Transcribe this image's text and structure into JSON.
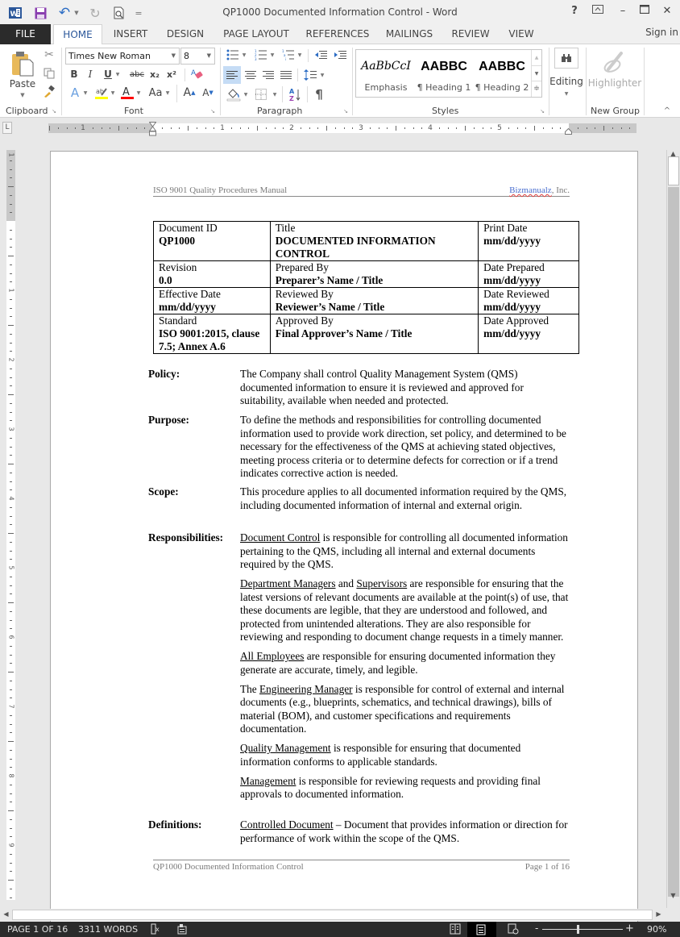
{
  "window": {
    "title": "QP1000 Documented Information Control - Word",
    "help": "?",
    "ribbon_display": "⊼",
    "minimize": "–",
    "maximize": "☐",
    "close": "✕"
  },
  "qat": {
    "app_icon": "W",
    "save_icon": "save-icon",
    "undo_icon": "↶",
    "redo_icon": "↻",
    "print_preview_icon": "print-preview-icon",
    "customize": "="
  },
  "tabs": [
    {
      "label": "FILE"
    },
    {
      "label": "HOME",
      "active": true
    },
    {
      "label": "INSERT"
    },
    {
      "label": "DESIGN"
    },
    {
      "label": "PAGE LAYOUT"
    },
    {
      "label": "REFERENCES"
    },
    {
      "label": "MAILINGS"
    },
    {
      "label": "REVIEW"
    },
    {
      "label": "VIEW"
    }
  ],
  "sign_in": "Sign in",
  "ribbon": {
    "clipboard": {
      "label": "Clipboard",
      "paste": "Paste"
    },
    "font": {
      "label": "Font",
      "font_name": "Times New Roman",
      "font_size": "8",
      "bold": "B",
      "italic": "I",
      "underline": "U",
      "strike": "abc",
      "subscript": "x₂",
      "superscript": "x²",
      "change_case": "Aa",
      "grow": "A",
      "shrink": "A",
      "text_effects": "A",
      "font_color": "A",
      "highlight_color": "#ffff00",
      "font_color_value": "#ff0000"
    },
    "paragraph": {
      "label": "Paragraph",
      "pilcrow": "¶"
    },
    "styles": {
      "label": "Styles",
      "items": [
        {
          "sample": "AaBbCcI",
          "name": "Emphasis"
        },
        {
          "sample": "AABBC",
          "name": "¶ Heading 1"
        },
        {
          "sample": "AABBC",
          "name": "¶ Heading 2"
        }
      ]
    },
    "editing": {
      "label": "Editing"
    },
    "new_group": {
      "label": "New Group",
      "highlighter": "Highlighter"
    }
  },
  "ruler": {
    "corner": "L",
    "numbers": [
      "1",
      "1",
      "2",
      "3",
      "4",
      "5"
    ],
    "vertical_numbers": [
      "1",
      "1",
      "2",
      "3",
      "4",
      "5",
      "6",
      "7",
      "8",
      "9"
    ]
  },
  "document": {
    "header_left": "ISO 9001 Quality Procedures Manual",
    "header_right_company": "Bizmanualz",
    "header_right_suffix": ", Inc.",
    "info_table": [
      [
        {
          "label": "Document ID",
          "value": "QP1000"
        },
        {
          "label": "Title",
          "value": "DOCUMENTED INFORMATION CONTROL"
        },
        {
          "label": "Print Date",
          "value": "mm/dd/yyyy"
        }
      ],
      [
        {
          "label": "Revision",
          "value": "0.0"
        },
        {
          "label": "Prepared By",
          "value": "Preparer’s Name / Title"
        },
        {
          "label": "Date Prepared",
          "value": "mm/dd/yyyy"
        }
      ],
      [
        {
          "label": "Effective Date",
          "value": "mm/dd/yyyy"
        },
        {
          "label": "Reviewed By",
          "value": "Reviewer’s Name / Title"
        },
        {
          "label": "Date Reviewed",
          "value": "mm/dd/yyyy"
        }
      ],
      [
        {
          "label": "Standard",
          "value": "ISO 9001:2015, clause 7.5; Annex A.6"
        },
        {
          "label": "Approved By",
          "value": "Final Approver’s Name / Title"
        },
        {
          "label": "Date Approved",
          "value": "mm/dd/yyyy"
        }
      ]
    ],
    "policy": {
      "label": "Policy:",
      "text": "The Company shall control Quality Management System (QMS) documented information to ensure it is reviewed and approved for suitability, available when needed and protected."
    },
    "purpose": {
      "label": "Purpose:",
      "text": "To define the methods and responsibilities for controlling documented information used to provide work direction, set policy, and determined to be necessary for the effectiveness of the QMS at achieving stated objectives, meeting process criteria or to determine defects for correction or if a trend indicates corrective action is needed."
    },
    "scope": {
      "label": "Scope:",
      "text": "This procedure applies to all documented information required by the QMS, including documented information of internal and external origin."
    },
    "responsibilities": {
      "label": "Responsibilities:",
      "paragraphs": [
        {
          "role": "Document Control",
          "text": " is responsible for controlling all documented information pertaining to the QMS, including all internal and external documents required by the QMS."
        },
        {
          "role": "Department Managers",
          "mid": " and ",
          "role2": "Supervisors",
          "text": " are responsible for ensuring that the latest versions of relevant documents are available at the point(s) of use, that these documents are legible, that they are understood and followed, and protected from unintended alterations. They are also responsible for reviewing and responding to document change requests in a timely manner."
        },
        {
          "role": "All Employees",
          "text": " are responsible for ensuring documented information they generate are accurate, timely, and legible."
        },
        {
          "prefix": "The ",
          "role": "Engineering Manager",
          "text": " is responsible for control of external and internal documents (e.g., blueprints, schematics, and technical drawings), bills of material (BOM), and customer specifications and requirements documentation."
        },
        {
          "role": "Quality Management",
          "text": " is responsible for ensuring that documented information conforms to applicable standards."
        },
        {
          "role": "Management",
          "text": " is responsible for reviewing requests and providing final approvals to documented information."
        }
      ]
    },
    "definitions": {
      "label": "Definitions:",
      "term": "Controlled Document",
      "text": " – Document that provides information or direction for performance of work within the scope of the QMS."
    },
    "footer_left": "QP1000 Documented Information Control",
    "footer_right": "Page 1 of 16"
  },
  "status_bar": {
    "page": "PAGE 1 OF 16",
    "words": "3311 WORDS",
    "zoom_level": "90%",
    "zoom_percent": 90,
    "zoom_minus": "-",
    "zoom_plus": "+"
  }
}
